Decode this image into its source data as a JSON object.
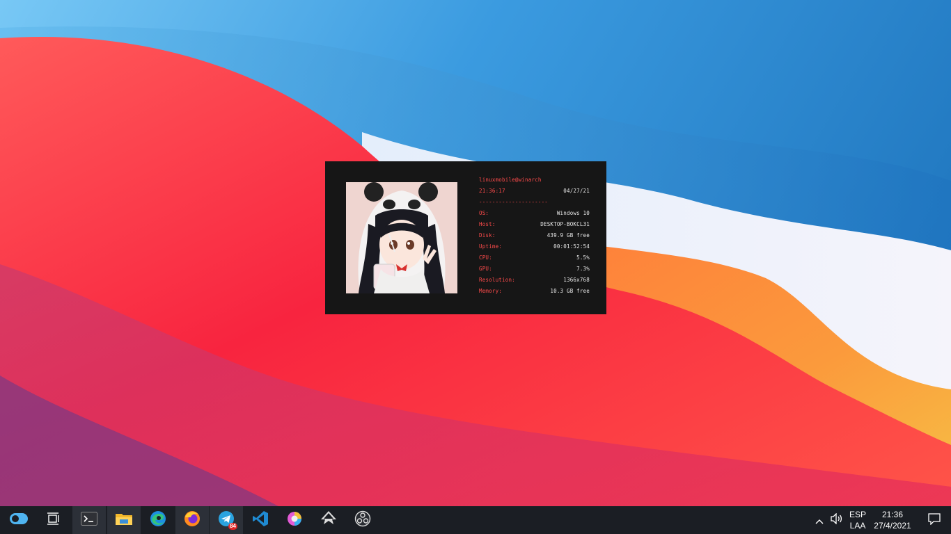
{
  "widget": {
    "user_host": "linuxmobile@winarch",
    "time": "21:36:17",
    "date": "04/27/21",
    "divider": "---------------------",
    "rows": [
      {
        "label": "OS:",
        "value": "Windows 10"
      },
      {
        "label": "Host:",
        "value": "DESKTOP-BOKCL31"
      },
      {
        "label": "Disk:",
        "value": "439.9 GB free"
      },
      {
        "label": "Uptime:",
        "value": "00:01:52:54"
      },
      {
        "label": "CPU:",
        "value": "5.5%"
      },
      {
        "label": "GPU:",
        "value": "7.3%"
      },
      {
        "label": "Resolution:",
        "value": "1366x768"
      },
      {
        "label": "Memory:",
        "value": "10.3 GB free"
      }
    ]
  },
  "taskbar": {
    "apps": [
      {
        "name": "toggle-icon"
      },
      {
        "name": "task-view-icon"
      },
      {
        "name": "terminal-icon"
      },
      {
        "name": "file-explorer-icon"
      },
      {
        "name": "edge-icon"
      },
      {
        "name": "firefox-icon"
      },
      {
        "name": "telegram-icon",
        "badge": "84"
      },
      {
        "name": "vscode-icon"
      },
      {
        "name": "color-app-icon"
      },
      {
        "name": "inkscape-icon"
      },
      {
        "name": "obs-icon"
      }
    ],
    "tray": {
      "language_top": "ESP",
      "language_bottom": "LAA",
      "clock_time": "21:36",
      "clock_date": "27/4/2021"
    }
  },
  "colors": {
    "accent_red": "#ff4b4b",
    "widget_bg": "#161616",
    "taskbar_bg": "#1b1e24"
  }
}
